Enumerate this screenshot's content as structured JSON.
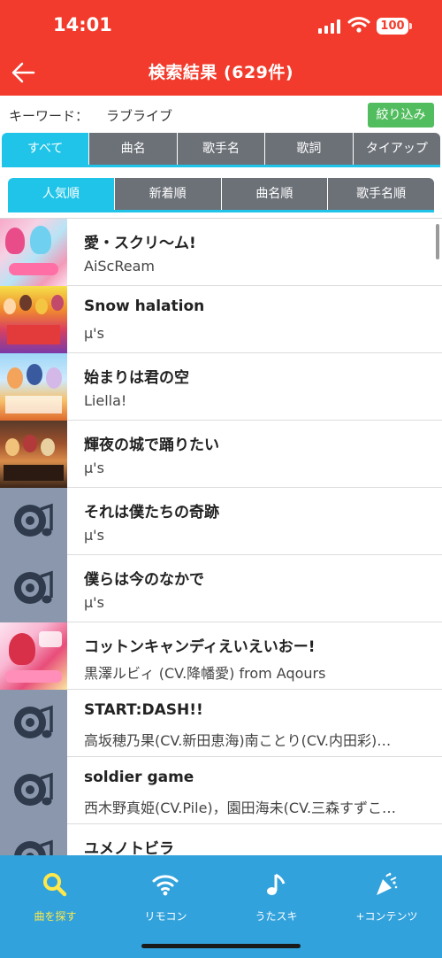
{
  "status_bar": {
    "time": "14:01",
    "battery": "100"
  },
  "header": {
    "title": "検索結果 (629件)"
  },
  "keyword": {
    "label": "キーワード：",
    "value": "ラブライブ",
    "filter_button": "絞り込み"
  },
  "category_tabs": [
    {
      "label": "すべて",
      "active": true
    },
    {
      "label": "曲名",
      "active": false
    },
    {
      "label": "歌手名",
      "active": false
    },
    {
      "label": "歌詞",
      "active": false
    },
    {
      "label": "タイアップ",
      "active": false
    }
  ],
  "sort_tabs": [
    {
      "label": "人気順",
      "active": true
    },
    {
      "label": "新着順",
      "active": false
    },
    {
      "label": "曲名順",
      "active": false
    },
    {
      "label": "歌手名順",
      "active": false
    }
  ],
  "results": [
    {
      "title": "愛・スクリ〜ム!",
      "artist": "AiScReam",
      "artwork": "album-art"
    },
    {
      "title": "Snow halation",
      "artist": "μ's",
      "artwork": "album-art"
    },
    {
      "title": "始まりは君の空",
      "artist": "Liella!",
      "artwork": "album-art"
    },
    {
      "title": "輝夜の城で踊りたい",
      "artist": "μ's",
      "artwork": "album-art"
    },
    {
      "title": "それは僕たちの奇跡",
      "artist": "μ's",
      "artwork": "disc-music-icon"
    },
    {
      "title": "僕らは今のなかで",
      "artist": "μ's",
      "artwork": "disc-music-icon"
    },
    {
      "title": "コットンキャンディえいえいおー!",
      "artist": "黒澤ルビィ (CV.降幡愛) from Aqours",
      "artwork": "album-art"
    },
    {
      "title": "START:DASH!!",
      "artist": "高坂穂乃果(CV.新田恵海)南ことり(CV.内田彩)…",
      "artwork": "disc-music-icon"
    },
    {
      "title": "soldier game",
      "artist": "西木野真姫(CV.Pile)，園田海未(CV.三森すずこ…",
      "artwork": "disc-music-icon"
    },
    {
      "title": "ユメノトビラ",
      "artist": "",
      "artwork": "disc-music-icon"
    }
  ],
  "tab_bar": [
    {
      "label": "曲を探す",
      "icon": "search-icon",
      "active": true
    },
    {
      "label": "リモコン",
      "icon": "wifi-icon",
      "active": false
    },
    {
      "label": "うたスキ",
      "icon": "music-note-icon",
      "active": false
    },
    {
      "label": "+コンテンツ",
      "icon": "party-popper-icon",
      "active": false
    }
  ],
  "colors": {
    "header_red": "#f23b2c",
    "accent_cyan": "#1fc4e8",
    "tab_gray": "#6c7178",
    "filter_green": "#52bd5e",
    "tabbar_blue": "#32a2dc",
    "active_tab_yellow": "#ffe94a"
  }
}
